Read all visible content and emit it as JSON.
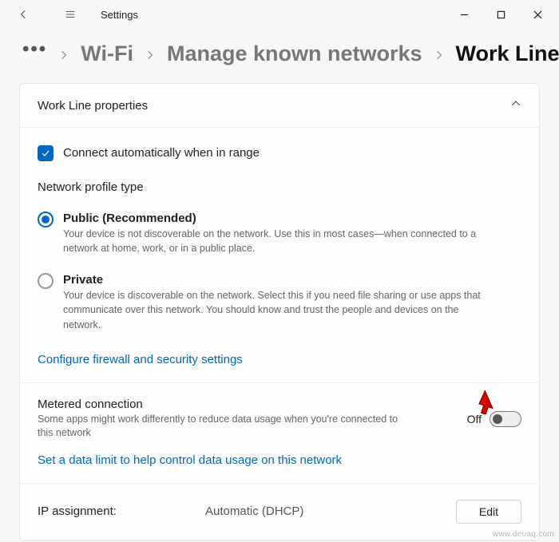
{
  "titlebar": {
    "title": "Settings"
  },
  "breadcrumb": {
    "wifi": "Wi-Fi",
    "manage": "Manage known networks",
    "current": "Work Line"
  },
  "card": {
    "header": "Work Line properties",
    "auto_connect": "Connect automatically when in range",
    "profile_title": "Network profile type",
    "public": {
      "title": "Public (Recommended)",
      "desc": "Your device is not discoverable on the network. Use this in most cases—when connected to a network at home, work, or in a public place."
    },
    "private": {
      "title": "Private",
      "desc": "Your device is discoverable on the network. Select this if you need file sharing or use apps that communicate over this network. You should know and trust the people and devices on the network."
    },
    "firewall_link": "Configure firewall and security settings",
    "metered": {
      "title": "Metered connection",
      "desc": "Some apps might work differently to reduce data usage when you're connected to this network",
      "state": "Off"
    },
    "datalimit_link": "Set a data limit to help control data usage on this network",
    "ip": {
      "label": "IP assignment:",
      "value": "Automatic (DHCP)",
      "edit": "Edit"
    }
  },
  "watermark": "www.deuaq.com"
}
